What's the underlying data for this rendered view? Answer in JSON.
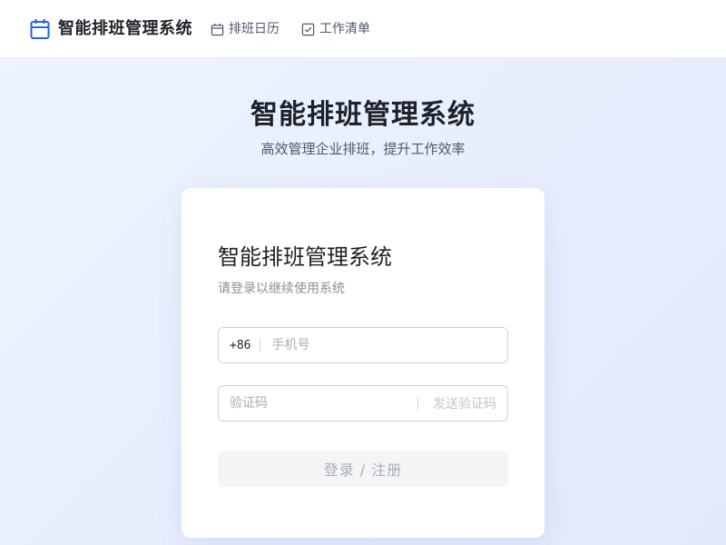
{
  "header": {
    "brand_title": "智能排班管理系统",
    "brand_icon": "calendar-icon",
    "nav": [
      {
        "label": "排班日历",
        "icon": "calendar-icon"
      },
      {
        "label": "工作清单",
        "icon": "checkbox-icon"
      }
    ]
  },
  "hero": {
    "title": "智能排班管理系统",
    "subtitle": "高效管理企业排班，提升工作效率"
  },
  "login": {
    "title": "智能排班管理系统",
    "subtitle": "请登录以继续使用系统",
    "phone_prefix": "+86",
    "phone_placeholder": "手机号",
    "code_placeholder": "验证码",
    "send_code_label": "发送验证码",
    "submit_label": "登录 / 注册"
  },
  "colors": {
    "accent": "#2563eb",
    "background_start": "#eef4ff",
    "background_end": "#e3e9fb",
    "disabled_button": "#f4f5f7",
    "disabled_text": "#a9aeb8"
  }
}
